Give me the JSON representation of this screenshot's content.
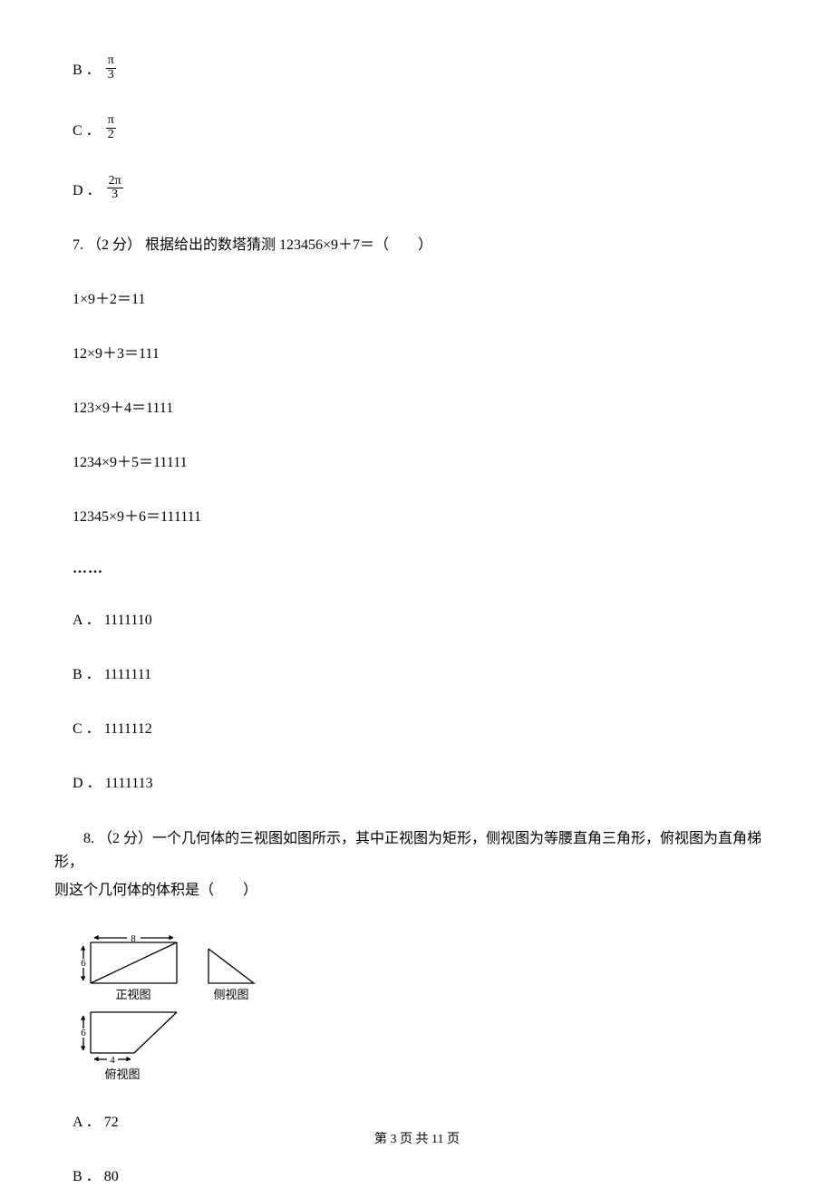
{
  "options_top": [
    {
      "label": "B ．",
      "num": "π",
      "den": "3"
    },
    {
      "label": "C ．",
      "num": "π",
      "den": "2"
    },
    {
      "label": "D ．",
      "num": "2π",
      "den": "3"
    }
  ],
  "q7": {
    "stem": "7.  （2 分）  根据给出的数塔猜测 123456×9＋7＝（　　）",
    "lines": [
      "1×9＋2＝11",
      "12×9＋3＝111",
      "123×9＋4＝1111",
      "1234×9＋5＝11111",
      "12345×9＋6＝111111"
    ],
    "ellipsis": "……",
    "choices": [
      {
        "label": "A ．",
        "text": "1111110"
      },
      {
        "label": "B ．",
        "text": "1111111"
      },
      {
        "label": "C ．",
        "text": "1111112"
      },
      {
        "label": "D ．",
        "text": "1111113"
      }
    ]
  },
  "q8": {
    "stem": "8.  （2 分）一个几何体的三视图如图所示，其中正视图为矩形，侧视图为等腰直角三角形，俯视图为直角梯形，",
    "stem2": "则这个几何体的体积是（　　）",
    "view_labels": {
      "front": "正视图",
      "side": "侧视图",
      "top": "俯视图"
    },
    "dims": {
      "front_w": "8",
      "front_h": "6",
      "top_h": "6",
      "top_w": "4"
    },
    "choices": [
      {
        "label": "A ．",
        "text": "72"
      },
      {
        "label": "B ．",
        "text": "80"
      }
    ]
  },
  "footer": "第 3 页 共 11 页"
}
